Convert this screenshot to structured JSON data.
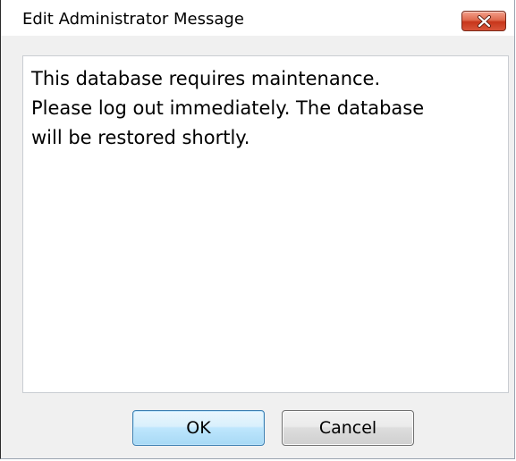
{
  "window": {
    "title": "Edit Administrator Message",
    "close_icon": "close-icon"
  },
  "message": {
    "text": "This database requires maintenance.\nPlease log out immediately. The database\nwill be restored shortly."
  },
  "buttons": {
    "ok_label": "OK",
    "cancel_label": "Cancel"
  },
  "colors": {
    "dialog_background": "#f0f0f0",
    "close_button": "#c7361b",
    "ok_button_border": "#3c7fb1"
  }
}
